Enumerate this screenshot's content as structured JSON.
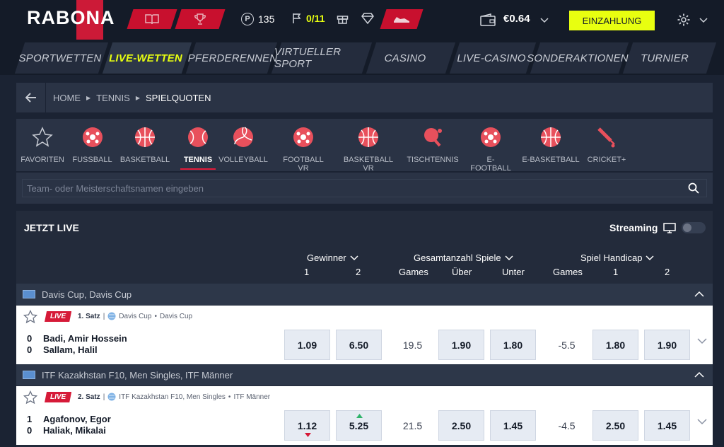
{
  "header": {
    "logo": "RABONA",
    "points": "135",
    "flags": "0/11",
    "balance": "€0.64",
    "deposit_label": "EINZAHLUNG"
  },
  "nav": [
    "SPORTWETTEN",
    "LIVE-WETTEN",
    "PFERDERENNEN",
    "VIRTUELLER SPORT",
    "CASINO",
    "LIVE-CASINO",
    "SONDERAKTIONEN",
    "TURNIER"
  ],
  "breadcrumb": {
    "home": "HOME",
    "tennis": "TENNIS",
    "current": "SPIELQUOTEN"
  },
  "sports": [
    "FAVORITEN",
    "FUSSBALL",
    "BASKETBALL",
    "TENNIS",
    "VOLLEYBALL",
    "FOOTBALL VR",
    "BASKETBALL VR",
    "TISCHTENNIS",
    "E-FOOTBALL",
    "E-BASKETBALL",
    "CRICKET+"
  ],
  "search": {
    "placeholder": "Team- oder Meisterschaftsnamen eingeben"
  },
  "live": {
    "title": "JETZT LIVE",
    "streaming": "Streaming"
  },
  "markets": {
    "winner": "Gewinner",
    "winner_1": "1",
    "winner_2": "2",
    "total": "Gesamtanzahl Spiele",
    "total_games": "Games",
    "total_over": "Über",
    "total_under": "Unter",
    "handicap": "Spiel Handicap",
    "handicap_games": "Games",
    "handicap_1": "1",
    "handicap_2": "2"
  },
  "groups": [
    {
      "name": "Davis Cup, Davis Cup",
      "match": {
        "live": "LIVE",
        "set": "1. Satz",
        "tour": "Davis Cup",
        "comp": "Davis Cup",
        "score1": "0",
        "score2": "0",
        "team1": "Badi, Amir Hossein",
        "team2": "Sallam, Halil",
        "w1": "1.09",
        "w2": "6.50",
        "games": "19.5",
        "over": "1.90",
        "under": "1.80",
        "hgames": "-5.5",
        "h1": "1.80",
        "h2": "1.90"
      }
    },
    {
      "name": "ITF Kazakhstan F10, Men Singles, ITF Männer",
      "match": {
        "live": "LIVE",
        "set": "2. Satz",
        "tour": "ITF Kazakhstan F10, Men Singles",
        "comp": "ITF Männer",
        "score1": "1",
        "score2": "0",
        "team1": "Agafonov, Egor",
        "team2": "Haliak, Mikalai",
        "w1": "1.12",
        "w2": "5.25",
        "games": "21.5",
        "over": "2.50",
        "under": "1.45",
        "hgames": "-4.5",
        "h1": "2.50",
        "h2": "1.45"
      }
    }
  ],
  "colors": {
    "accent": "#e8ff10",
    "brand": "#d61a38",
    "bg": "#1b2333"
  }
}
